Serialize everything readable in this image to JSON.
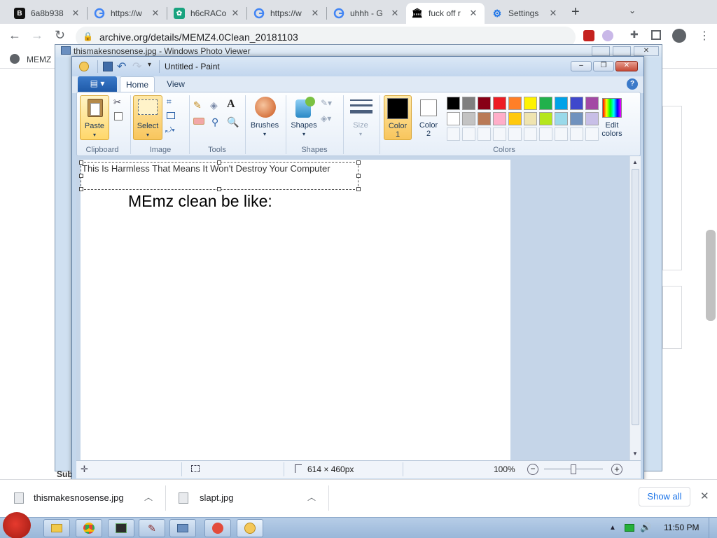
{
  "browser": {
    "tabs": [
      {
        "title": "6a8b938",
        "favicon": "b-logo-icon",
        "active": false
      },
      {
        "title": "https://w",
        "favicon": "google-icon",
        "active": false
      },
      {
        "title": "h6cRACo",
        "favicon": "chatgpt-icon",
        "active": false
      },
      {
        "title": "https://w",
        "favicon": "google-icon",
        "active": false
      },
      {
        "title": "uhhh - G",
        "favicon": "google-icon",
        "active": false
      },
      {
        "title": "fuck off r",
        "favicon": "archive-icon",
        "active": true
      },
      {
        "title": "Settings",
        "favicon": "gear-icon",
        "active": false
      }
    ],
    "address": "archive.org/details/MEMZ4.0Clean_20181103",
    "bookmark": "MEMZ"
  },
  "photo_viewer": {
    "title": "thismakesnosense.jpg - Windows Photo Viewer",
    "bottom_text": "Sub"
  },
  "paint": {
    "title": "Untitled - Paint",
    "tabs": [
      "Home",
      "View"
    ],
    "groups": {
      "clipboard": {
        "label": "Clipboard",
        "paste": "Paste"
      },
      "image": {
        "label": "Image",
        "select": "Select"
      },
      "tools": {
        "label": "Tools"
      },
      "brushes": "Brushes",
      "shapes": {
        "label": "Shapes",
        "button": "Shapes"
      },
      "size": "Size",
      "colors": {
        "label": "Colors",
        "color1": "Color",
        "color1_num": "1",
        "color2": "Color",
        "color2_num": "2",
        "edit": "Edit",
        "edit2": "colors"
      }
    },
    "palette": [
      "#000000",
      "#7f7f7f",
      "#880015",
      "#ed1c24",
      "#ff7f27",
      "#fff200",
      "#22b14c",
      "#00a2e8",
      "#3f48cc",
      "#a349a4",
      "#ffffff",
      "#c3c3c3",
      "#b97a57",
      "#ffaec9",
      "#ffc90e",
      "#efe4b0",
      "#b5e61d",
      "#99d9ea",
      "#7092be",
      "#c8bfe7"
    ],
    "canvas": {
      "text_selection": "This Is Harmless That Means It Won't Destroy Your Computer",
      "big_text": "MEmz clean be like:"
    },
    "status": {
      "size": "614 × 460px",
      "zoom": "100%"
    }
  },
  "downloads": {
    "items": [
      "thismakesnosense.jpg",
      "slapt.jpg"
    ],
    "show_all": "Show all"
  },
  "taskbar": {
    "time": "11:50 PM"
  }
}
